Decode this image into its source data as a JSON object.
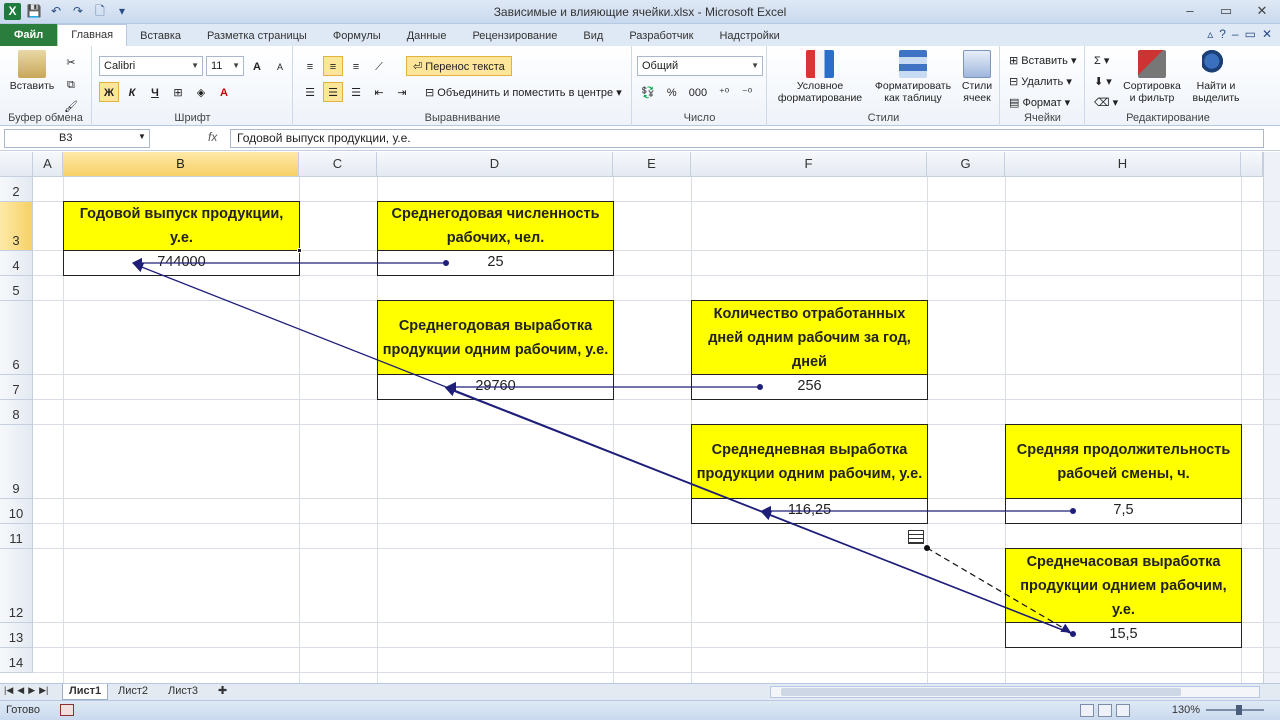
{
  "titlebar": {
    "title": "Зависимые и влияющие ячейки.xlsx  -  Microsoft Excel",
    "app_icon": "X",
    "minimize": "–",
    "restore": "▭",
    "close": "✕"
  },
  "tabs": [
    {
      "label": "Файл"
    },
    {
      "label": "Главная"
    },
    {
      "label": "Вставка"
    },
    {
      "label": "Разметка страницы"
    },
    {
      "label": "Формулы"
    },
    {
      "label": "Данные"
    },
    {
      "label": "Рецензирование"
    },
    {
      "label": "Вид"
    },
    {
      "label": "Разработчик"
    },
    {
      "label": "Надстройки"
    }
  ],
  "ribbon": {
    "clipboard": {
      "label": "Буфер обмена",
      "paste": "Вставить"
    },
    "font": {
      "label": "Шрифт",
      "name": "Calibri",
      "size": "11",
      "bold": "Ж",
      "italic": "К",
      "underline": "Ч",
      "grow": "A",
      "shrink": "A"
    },
    "alignment": {
      "label": "Выравнивание",
      "wrap": "Перенос текста",
      "merge": "Объединить и поместить в центре"
    },
    "number": {
      "label": "Число",
      "format": "Общий",
      "percent": "%",
      "thousands": "000"
    },
    "styles": {
      "label": "Стили",
      "conditional": "Условное форматирование",
      "as_table": "Форматировать как таблицу",
      "cell_styles": "Стили ячеек"
    },
    "cells": {
      "label": "Ячейки",
      "insert": "Вставить",
      "delete": "Удалить",
      "format": "Формат"
    },
    "editing": {
      "label": "Редактирование",
      "sort": "Сортировка и фильтр",
      "find": "Найти и выделить"
    }
  },
  "formula_bar": {
    "name_box": "B3",
    "fx": "fx",
    "content": "Годовой выпуск продукции, у.е."
  },
  "columns": [
    "A",
    "B",
    "C",
    "D",
    "E",
    "F",
    "G",
    "H"
  ],
  "rows": [
    "2",
    "3",
    "4",
    "5",
    "6",
    "7",
    "8",
    "9",
    "10",
    "11",
    "12",
    "13",
    "14"
  ],
  "cells": {
    "b3": "Годовой выпуск продукции, у.е.",
    "b4": "744000",
    "d3": "Среднегодовая численность рабочих, чел.",
    "d4": "25",
    "d6": "Среднегодовая выработка продукции одним рабочим, у.е.",
    "d7": "29760",
    "f6": "Количество отработанных дней одним рабочим за год, дней",
    "f7": "256",
    "f9": "Среднедневная выработка продукции одним рабочим, у.е.",
    "f10": "116,25",
    "h9": "Средняя продолжительность рабочей смены, ч.",
    "h10": "7,5",
    "h12": "Среднечасовая выработка продукции однием рабочим, у.е.",
    "h13": "15,5"
  },
  "colors": {
    "header_fill": "#ffff00",
    "arrow": "#1f1f7a",
    "selected_header": "#f7d167"
  },
  "sheets": [
    {
      "label": "Лист1"
    },
    {
      "label": "Лист2"
    },
    {
      "label": "Лист3"
    }
  ],
  "status": {
    "ready": "Готово",
    "zoom": "130%"
  }
}
